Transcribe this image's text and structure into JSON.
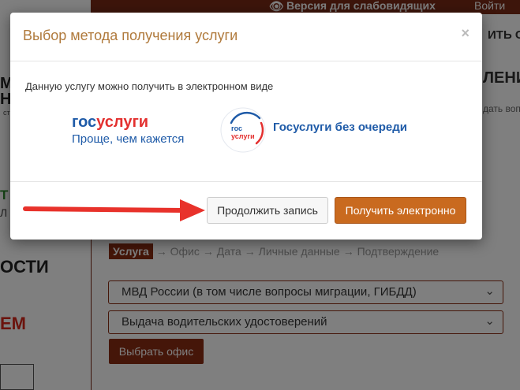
{
  "header": {
    "accessibility_label": "Версия для слабовидящих",
    "login_label": "Войти"
  },
  "left_fragments": [
    "М",
    "Н",
    "ОСТИ",
    "ЕМ",
    "Т",
    "Л",
    "стр"
  ],
  "right_fragments": [
    "ИТЬ СТ",
    "ЛЕНИ",
    "дать вопр"
  ],
  "steps": {
    "active": "Услуга",
    "items": [
      "→ Офис",
      "→ Дата",
      "→ Личные данные",
      "→ Подтверждение"
    ]
  },
  "selects": [
    {
      "value": "МВД России (в том числе вопросы миграции, ГИБДД)"
    },
    {
      "value": "Выдача водительских удостоверений"
    }
  ],
  "select_office_label": "Выбрать офис",
  "modal": {
    "title": "Выбор метода получения услуги",
    "close_label": "×",
    "text": "Данную услугу можно получить в электронном виде",
    "gosuslugi": {
      "part1": "гос",
      "part2": "услуги",
      "tagline": "Проще, чем кажется"
    },
    "queue": {
      "emblem_top": "гос",
      "emblem_bottom": "услуги",
      "title": "Госуслуги без очереди"
    },
    "continue_label": "Продолжить запись",
    "electronic_label": "Получить электронно"
  },
  "colors": {
    "brand_dark": "#8a2c12",
    "accent_orange": "#c96a1f",
    "gos_blue": "#1f5ba8",
    "gos_red": "#e3302f",
    "arrow_red": "#e8322b",
    "title_color": "#b07a3c"
  },
  "icons": {
    "eye": "eye-icon",
    "chevron": "chevron-down-icon",
    "close": "close-icon",
    "arrow": "arrow-right-icon"
  }
}
